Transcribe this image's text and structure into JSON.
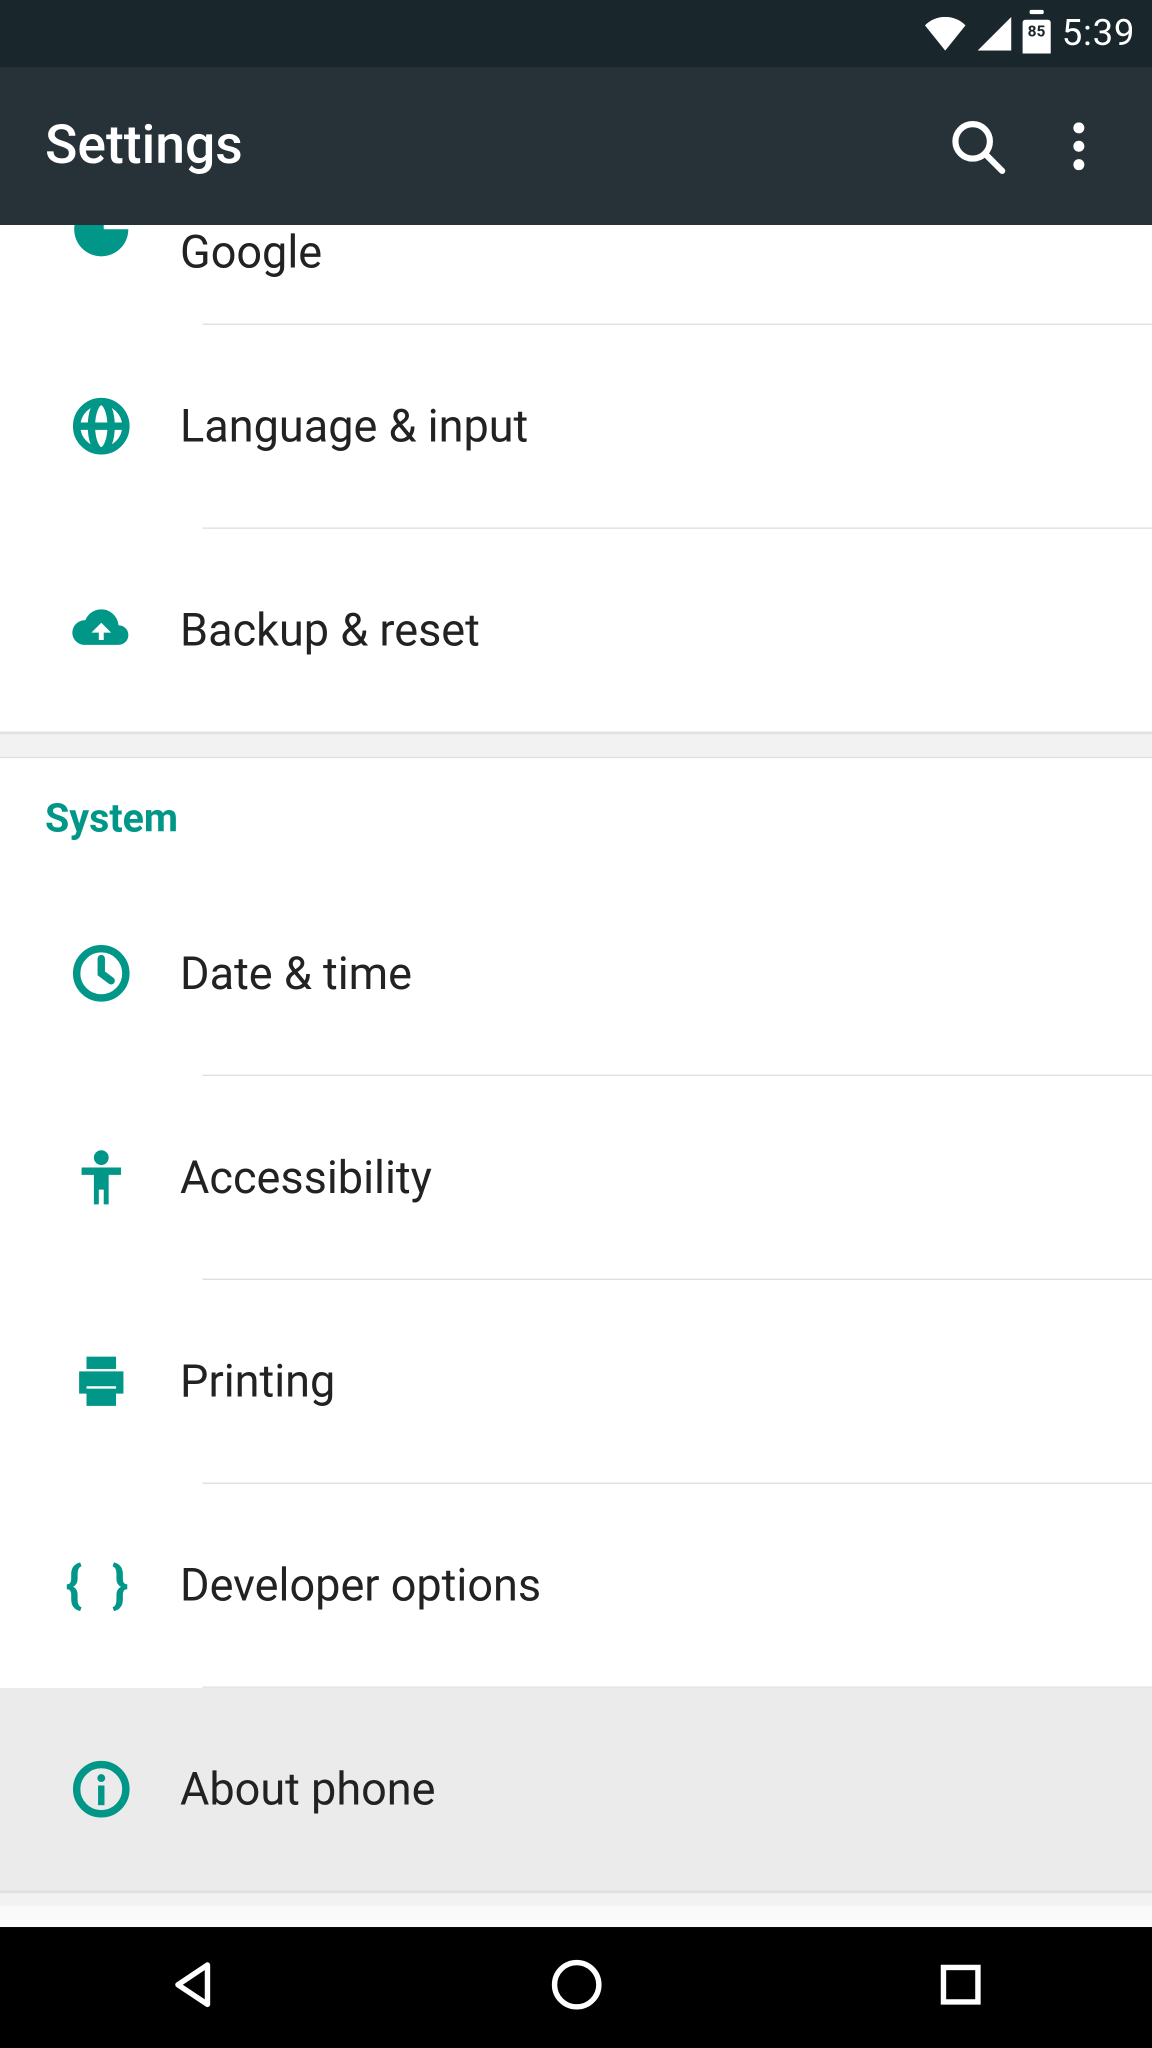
{
  "status": {
    "battery": "85",
    "time": "5:39"
  },
  "header": {
    "title": "Settings"
  },
  "section_personal": {
    "items": [
      {
        "label": "Google"
      },
      {
        "label": "Language & input"
      },
      {
        "label": "Backup & reset"
      }
    ]
  },
  "section_system": {
    "title": "System",
    "items": [
      {
        "label": "Date & time"
      },
      {
        "label": "Accessibility"
      },
      {
        "label": "Printing"
      },
      {
        "label": "Developer options"
      },
      {
        "label": "About phone"
      }
    ]
  },
  "colors": {
    "accent": "#009688",
    "appbar": "#263238",
    "status": "#19262c"
  }
}
